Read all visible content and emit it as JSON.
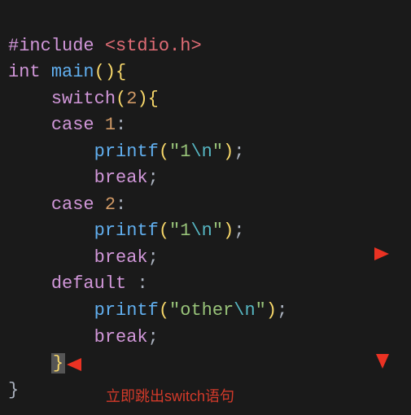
{
  "code": {
    "line1_preproc": "#include",
    "line1_path": "<stdio.h>",
    "line2_type": "int",
    "line2_func": "main",
    "line2_parens": "()",
    "line2_brace": "{",
    "line3_switch": "switch",
    "line3_arg": "2",
    "line3_brace": "{",
    "line4_case": "case",
    "line4_val": "1",
    "line5_printf": "printf",
    "line5_str_open": "\"",
    "line5_str_body": "1",
    "line5_esc": "\\n",
    "line5_str_close": "\"",
    "line6_break": "break",
    "line7_case": "case",
    "line7_val": "2",
    "line8_printf": "printf",
    "line8_str_body": "1",
    "line8_esc": "\\n",
    "line9_break": "break",
    "line10_default": "default",
    "line11_printf": "printf",
    "line11_str_body": "other",
    "line11_esc": "\\n",
    "line12_break": "break",
    "line13_brace": "}",
    "line14_brace": "}"
  },
  "annotation": "立即跳出switch语句"
}
